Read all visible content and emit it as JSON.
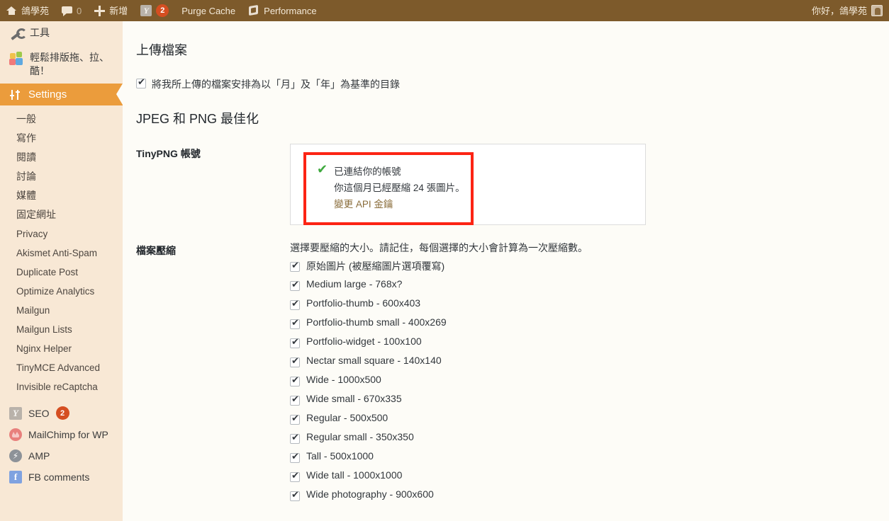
{
  "adminbar": {
    "items": [
      {
        "icon": "house-icon",
        "label": "鴿學苑"
      },
      {
        "icon": "comment-bubble-icon",
        "label": "0"
      },
      {
        "icon": "plus-icon",
        "label": "新增"
      },
      {
        "icon": "yoast-icon",
        "label": "2"
      },
      {
        "icon": "",
        "label": "Purge Cache"
      },
      {
        "icon": "cube-icon",
        "label": "Performance"
      }
    ],
    "account_greeting": "你好，鴿學苑"
  },
  "sidebar": {
    "top_items": [
      {
        "icon": "wrench-icon",
        "label": "工具"
      },
      {
        "icon": "blocks-icon",
        "label": "輕鬆排版拖、拉、酷！"
      }
    ],
    "current": {
      "icon": "settings-sliders-icon",
      "label": "Settings"
    },
    "submenu": [
      "一般",
      "寫作",
      "閱讀",
      "討論",
      "媒體",
      "固定網址",
      "Privacy",
      "Akismet Anti-Spam",
      "Duplicate Post",
      "Optimize Analytics",
      "Mailgun",
      "Mailgun Lists",
      "Nginx Helper",
      "TinyMCE Advanced",
      "Invisible reCaptcha"
    ],
    "plugins": [
      {
        "icon": "yoast-icon",
        "label": "SEO",
        "badge": "2"
      },
      {
        "icon": "mailchimp-icon",
        "label": "MailChimp for WP",
        "badge": ""
      },
      {
        "icon": "amp-icon",
        "label": "AMP",
        "badge": ""
      },
      {
        "icon": "facebook-icon",
        "label": "FB comments",
        "badge": ""
      }
    ]
  },
  "main": {
    "upload_heading": "上傳檔案",
    "organize_checkbox_label": "將我所上傳的檔案安排為以「月」及「年」為基準的目錄",
    "optimization_heading": "JPEG 和 PNG 最佳化",
    "tinypng": {
      "label": "TinyPNG 帳號",
      "connected_text": "已連結你的帳號",
      "usage_text": "你這個月已經壓縮 24 張圖片。",
      "change_key_link": "變更 API 金鑰",
      "highlight_color": "#fc2414",
      "check_color": "#3fa93f"
    },
    "compression": {
      "label": "檔案壓縮",
      "description": "選擇要壓縮的大小。請記住，每個選擇的大小會計算為一次壓縮數。",
      "sizes": [
        "原始圖片 (被壓縮圖片選項覆寫)",
        "Medium large - 768x?",
        "Portfolio-thumb - 600x403",
        "Portfolio-thumb small - 400x269",
        "Portfolio-widget - 100x100",
        "Nectar small square - 140x140",
        "Wide - 1000x500",
        "Wide small - 670x335",
        "Regular - 500x500",
        "Regular small - 350x350",
        "Tall - 500x1000",
        "Wide tall - 1000x1000",
        "Wide photography - 900x600"
      ]
    }
  }
}
